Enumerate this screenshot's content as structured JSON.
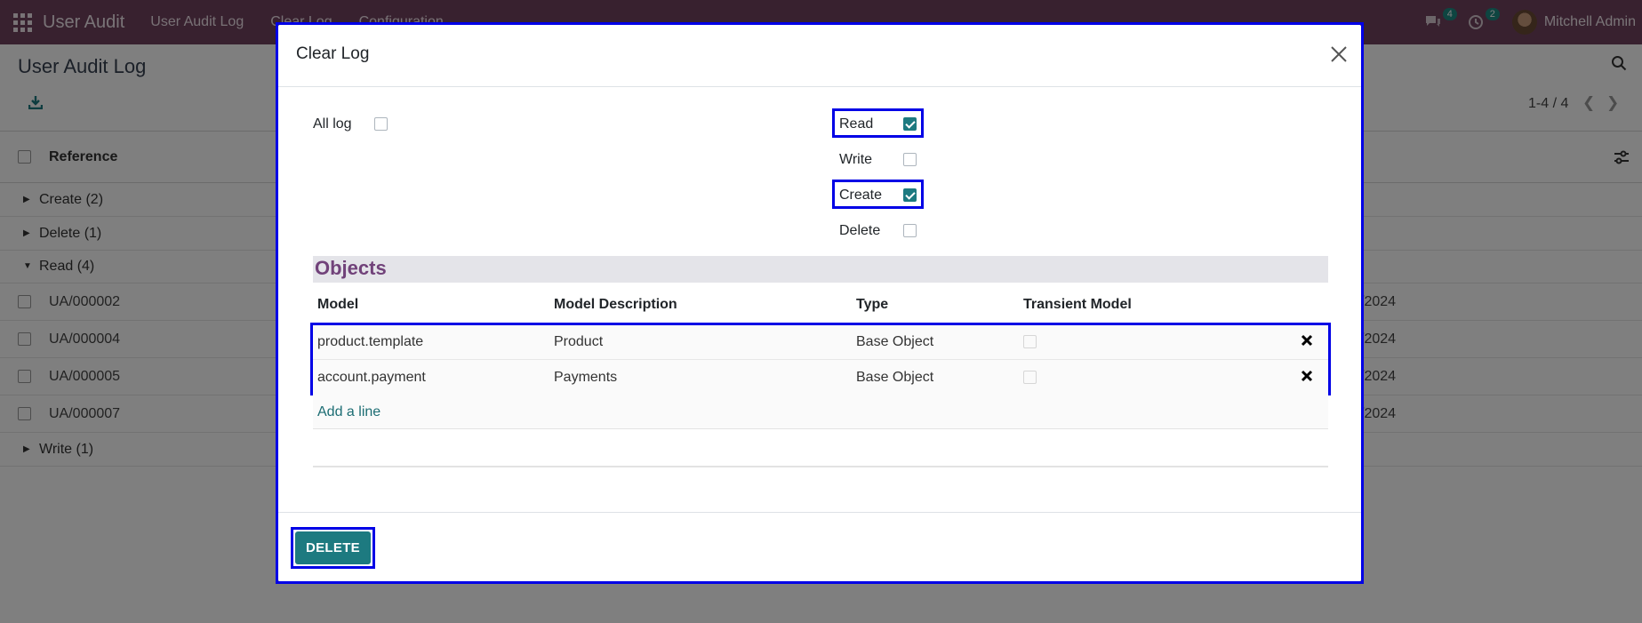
{
  "navbar": {
    "app_name": "User Audit",
    "menu": [
      "User Audit Log",
      "Clear Log",
      "Configuration"
    ],
    "messages_count": "4",
    "activities_count": "2",
    "user_name": "Mitchell Admin"
  },
  "control_panel": {
    "title": "User Audit Log",
    "pager": "1-4 / 4"
  },
  "list": {
    "column_reference": "Reference",
    "groups": [
      {
        "label": "Create (2)"
      },
      {
        "label": "Delete (1)"
      },
      {
        "label": "Read (4)"
      },
      {
        "label": "Write (1)"
      }
    ],
    "records": [
      {
        "ref": "UA/000002",
        "date": "/2024"
      },
      {
        "ref": "UA/000004",
        "date": "/2024"
      },
      {
        "ref": "UA/000005",
        "date": "/2024"
      },
      {
        "ref": "UA/000007",
        "date": "/2024"
      }
    ]
  },
  "dialog": {
    "title": "Clear Log",
    "all_log_label": "All log",
    "all_log_checked": false,
    "operations": [
      {
        "label": "Read",
        "checked": true
      },
      {
        "label": "Write",
        "checked": false
      },
      {
        "label": "Create",
        "checked": true
      },
      {
        "label": "Delete",
        "checked": false
      }
    ],
    "objects_title": "Objects",
    "columns": [
      "Model",
      "Model Description",
      "Type",
      "Transient Model"
    ],
    "rows": [
      {
        "model": "product.template",
        "description": "Product",
        "type": "Base Object",
        "transient": false
      },
      {
        "model": "account.payment",
        "description": "Payments",
        "type": "Base Object",
        "transient": false
      }
    ],
    "add_line_label": "Add a line",
    "delete_button_label": "DELETE"
  },
  "colors": {
    "navbar": "#71425f",
    "primary": "#1d7a80",
    "section_title": "#71427a",
    "highlight": "#0000e6"
  }
}
